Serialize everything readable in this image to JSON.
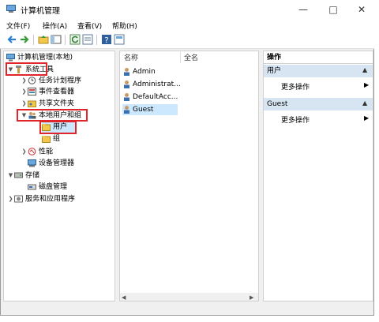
{
  "window": {
    "title": "计算机管理"
  },
  "menu": [
    "文件(F)",
    "操作(A)",
    "查看(V)",
    "帮助(H)"
  ],
  "tree": {
    "root": "计算机管理(本地)",
    "system_tools": "系统工具",
    "task_scheduler": "任务计划程序",
    "event_viewer": "事件查看器",
    "shared_folders": "共享文件夹",
    "local_users_groups": "本地用户和组",
    "users": "用户",
    "groups": "组",
    "performance": "性能",
    "device_manager": "设备管理器",
    "storage": "存储",
    "disk_management": "磁盘管理",
    "services_apps": "服务和应用程序"
  },
  "list": {
    "col_name": "名称",
    "col_fullname": "全名",
    "rows": [
      "Admin",
      "Administrat...",
      "DefaultAcc...",
      "Guest"
    ]
  },
  "actions": {
    "header": "操作",
    "section1": "用户",
    "more1": "更多操作",
    "section2": "Guest",
    "more2": "更多操作"
  },
  "colors": {
    "accent": "#e0262b",
    "selection": "#cce8ff",
    "action_header": "#d7e4f2"
  }
}
